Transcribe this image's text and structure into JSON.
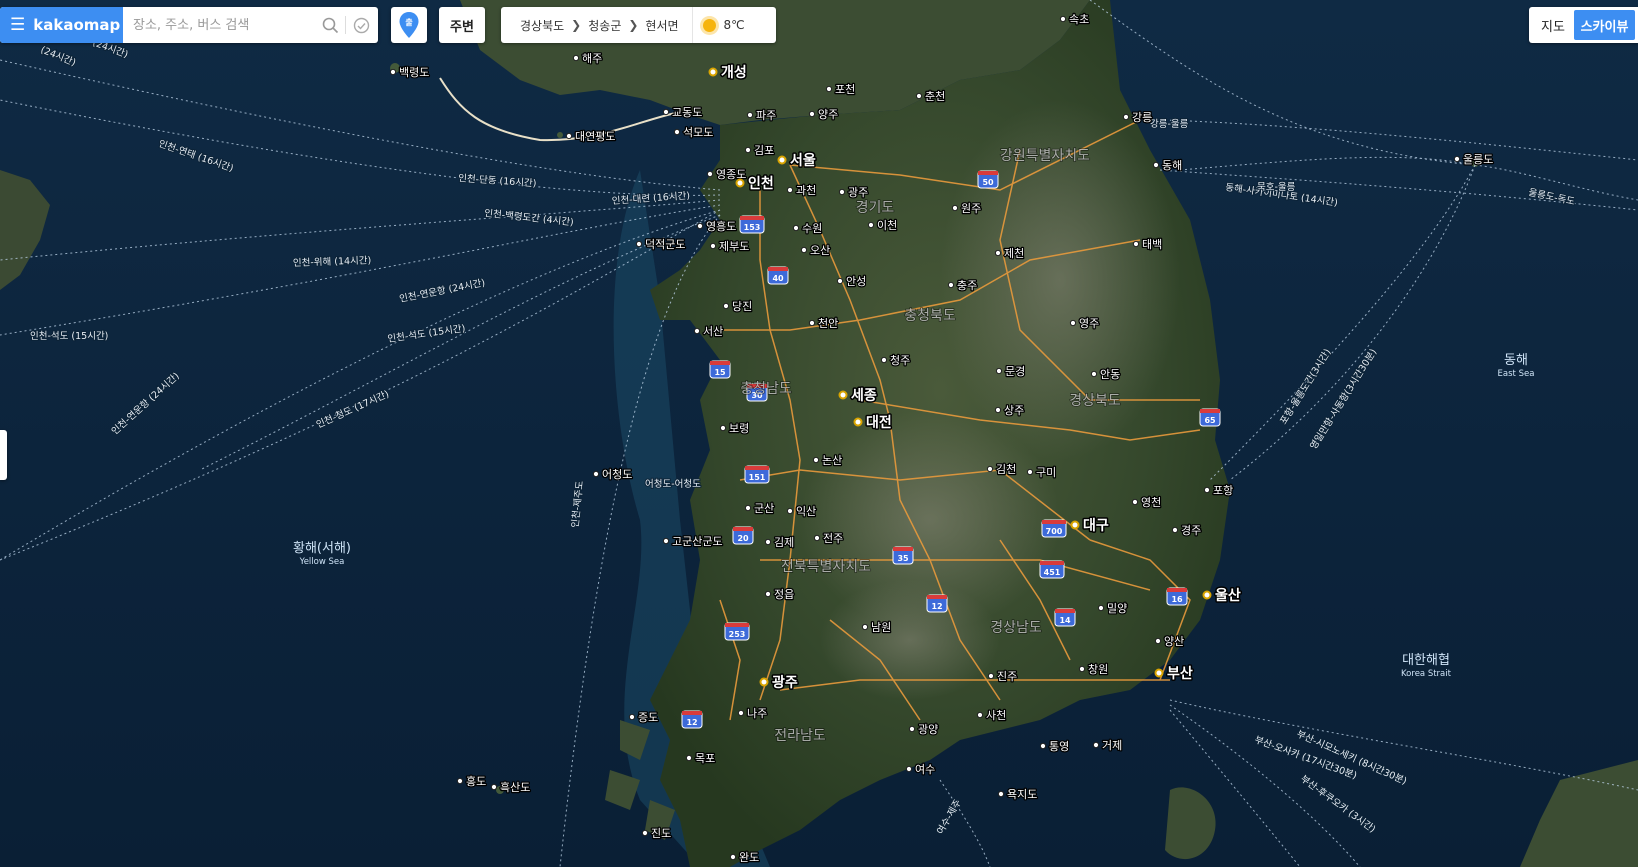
{
  "app": {
    "brand": "kakaomap",
    "search_placeholder": "장소, 주소, 버스 검색",
    "nearby_label": "주변",
    "pin_label": "출"
  },
  "location": {
    "crumbs": [
      "경상북도",
      "청송군",
      "현서면"
    ],
    "temperature": "8℃"
  },
  "map_type": {
    "map_label": "지도",
    "skyview_label": "스카이뷰",
    "active": "skyview"
  },
  "map": {
    "major_cities": [
      {
        "id": "seoul",
        "name": "서울"
      },
      {
        "id": "incheon",
        "name": "인천"
      },
      {
        "id": "sejong",
        "name": "세종"
      },
      {
        "id": "daejeon",
        "name": "대전"
      },
      {
        "id": "daegu",
        "name": "대구"
      },
      {
        "id": "ulsan",
        "name": "울산"
      },
      {
        "id": "busan",
        "name": "부산"
      },
      {
        "id": "gwangju",
        "name": "광주"
      },
      {
        "id": "gaeseong",
        "name": "개성"
      }
    ],
    "cities": [
      {
        "id": "sokcho",
        "name": "속초"
      },
      {
        "id": "haeju",
        "name": "해주"
      },
      {
        "id": "baengnyeongdo",
        "name": "백령도"
      },
      {
        "id": "pocheon",
        "name": "포천"
      },
      {
        "id": "chuncheon",
        "name": "춘천"
      },
      {
        "id": "gyodongdo",
        "name": "교동도"
      },
      {
        "id": "paju",
        "name": "파주"
      },
      {
        "id": "yangju",
        "name": "양주"
      },
      {
        "id": "seokmodo",
        "name": "석모도"
      },
      {
        "id": "daeyeonpyeongdo",
        "name": "대연평도"
      },
      {
        "id": "gangneung",
        "name": "강릉"
      },
      {
        "id": "gimpo",
        "name": "김포"
      },
      {
        "id": "yeongjongdo",
        "name": "영종도"
      },
      {
        "id": "gwacheon",
        "name": "과천"
      },
      {
        "id": "gwangju_gg",
        "name": "광주"
      },
      {
        "id": "donghae",
        "name": "동해"
      },
      {
        "id": "ulleungdo",
        "name": "울릉도"
      },
      {
        "id": "wonju",
        "name": "원주"
      },
      {
        "id": "yeongheungdo",
        "name": "영흥도"
      },
      {
        "id": "suwon",
        "name": "수원"
      },
      {
        "id": "icheon",
        "name": "이천"
      },
      {
        "id": "deokjeokgundo",
        "name": "덕적군도"
      },
      {
        "id": "jebudo",
        "name": "제부도"
      },
      {
        "id": "osan",
        "name": "오산"
      },
      {
        "id": "jecheon",
        "name": "제천"
      },
      {
        "id": "taebaek",
        "name": "태백"
      },
      {
        "id": "anseong",
        "name": "안성"
      },
      {
        "id": "chungju",
        "name": "충주"
      },
      {
        "id": "dangjin",
        "name": "당진"
      },
      {
        "id": "seosan",
        "name": "서산"
      },
      {
        "id": "cheonan",
        "name": "천안"
      },
      {
        "id": "yeongju",
        "name": "영주"
      },
      {
        "id": "cheongju",
        "name": "청주"
      },
      {
        "id": "mungyeong",
        "name": "문경"
      },
      {
        "id": "andong",
        "name": "안동"
      },
      {
        "id": "sangju",
        "name": "상주"
      },
      {
        "id": "boryeong",
        "name": "보령"
      },
      {
        "id": "nonsan",
        "name": "논산"
      },
      {
        "id": "gimcheon",
        "name": "김천"
      },
      {
        "id": "gumi",
        "name": "구미"
      },
      {
        "id": "eocheongdo",
        "name": "어청도"
      },
      {
        "id": "pohang",
        "name": "포항"
      },
      {
        "id": "gunsan",
        "name": "군산"
      },
      {
        "id": "iksan",
        "name": "익산"
      },
      {
        "id": "yeongcheon",
        "name": "영천"
      },
      {
        "id": "gogunsangundo",
        "name": "고군산군도"
      },
      {
        "id": "gimje",
        "name": "김제"
      },
      {
        "id": "jeonju",
        "name": "전주"
      },
      {
        "id": "gyeongju",
        "name": "경주"
      },
      {
        "id": "jeongeup",
        "name": "정읍"
      },
      {
        "id": "miryang",
        "name": "밀양"
      },
      {
        "id": "namwon",
        "name": "남원"
      },
      {
        "id": "yangsan",
        "name": "양산"
      },
      {
        "id": "changwon",
        "name": "창원"
      },
      {
        "id": "jinju",
        "name": "진주"
      },
      {
        "id": "jeungdo",
        "name": "증도"
      },
      {
        "id": "naju",
        "name": "나주"
      },
      {
        "id": "sacheon",
        "name": "사천"
      },
      {
        "id": "gwangyang",
        "name": "광양"
      },
      {
        "id": "tongyeong",
        "name": "통영"
      },
      {
        "id": "geoje",
        "name": "거제"
      },
      {
        "id": "mokpo",
        "name": "목포"
      },
      {
        "id": "hongdo",
        "name": "홍도"
      },
      {
        "id": "heuksando",
        "name": "흑산도"
      },
      {
        "id": "yeosu",
        "name": "여수"
      },
      {
        "id": "yokjido",
        "name": "욕지도"
      },
      {
        "id": "jindo",
        "name": "진도"
      },
      {
        "id": "wando",
        "name": "완도"
      }
    ],
    "provinces": [
      {
        "id": "gangwon",
        "name": "강원특별자치도"
      },
      {
        "id": "gyeonggi",
        "name": "경기도"
      },
      {
        "id": "chungbuk",
        "name": "충청북도"
      },
      {
        "id": "chungnam",
        "name": "충청남도"
      },
      {
        "id": "gyeongbuk",
        "name": "경상북도"
      },
      {
        "id": "jeonbuk",
        "name": "전북특별자치도"
      },
      {
        "id": "gyeongnam",
        "name": "경상남도"
      },
      {
        "id": "jeonnam",
        "name": "전라남도"
      }
    ],
    "seas": [
      {
        "id": "yellow",
        "name": "황해(서해)",
        "en": "Yellow Sea"
      },
      {
        "id": "east",
        "name": "동해",
        "en": "East Sea"
      },
      {
        "id": "korea_strait",
        "name": "대한해협",
        "en": "Korea Strait"
      }
    ],
    "ferry_routes": [
      {
        "id": "r1",
        "name": "인천-단동 (16시간)"
      },
      {
        "id": "r2",
        "name": "인천-대련 (16시간)"
      },
      {
        "id": "r3",
        "name": "인천-연태 (16시간)"
      },
      {
        "id": "r4",
        "name": "인천-백령도간 (4시간)"
      },
      {
        "id": "r5",
        "name": "인천-위해 (14시간)"
      },
      {
        "id": "r6",
        "name": "인천-연운항 (24시간)"
      },
      {
        "id": "r7",
        "name": "인천-석도 (15시간)"
      },
      {
        "id": "r8",
        "name": "인천-석도 (15시간)"
      },
      {
        "id": "r9",
        "name": "인천-연운항 (24시간)"
      },
      {
        "id": "r10",
        "name": "인천-청도 (17시간)"
      },
      {
        "id": "r11",
        "name": "인천-제주도"
      },
      {
        "id": "r12",
        "name": "동해-사카이미나토 (14시간)"
      },
      {
        "id": "r13",
        "name": "묵호-울릉"
      },
      {
        "id": "r14",
        "name": "울릉도-독도"
      },
      {
        "id": "r15",
        "name": "포항-울릉도간(3시간)"
      },
      {
        "id": "r16",
        "name": "영일만항-사동항(3시간30분)"
      },
      {
        "id": "r17",
        "name": "부산-시모노세키 (8시간30분)"
      },
      {
        "id": "r18",
        "name": "부산-오사카 (17시간30분)"
      },
      {
        "id": "r19",
        "name": "부산-후쿠오카 (3시간)"
      },
      {
        "id": "r20",
        "name": "어청도-어청도"
      },
      {
        "id": "r21",
        "name": "(24시간)"
      },
      {
        "id": "r22",
        "name": "강릉-울릉"
      },
      {
        "id": "r23",
        "name": "여수-제주"
      }
    ],
    "highways": [
      {
        "id": "h50",
        "num": "50"
      },
      {
        "id": "h153",
        "num": "153"
      },
      {
        "id": "h40",
        "num": "40"
      },
      {
        "id": "h15",
        "num": "15"
      },
      {
        "id": "h30",
        "num": "30"
      },
      {
        "id": "h65",
        "num": "65"
      },
      {
        "id": "h151",
        "num": "151"
      },
      {
        "id": "h20",
        "num": "20"
      },
      {
        "id": "h35",
        "num": "35"
      },
      {
        "id": "h700",
        "num": "700"
      },
      {
        "id": "h451",
        "num": "451"
      },
      {
        "id": "h12a",
        "num": "12"
      },
      {
        "id": "h16",
        "num": "16"
      },
      {
        "id": "h14",
        "num": "14"
      },
      {
        "id": "h253",
        "num": "253"
      },
      {
        "id": "h12b",
        "num": "12"
      }
    ]
  }
}
